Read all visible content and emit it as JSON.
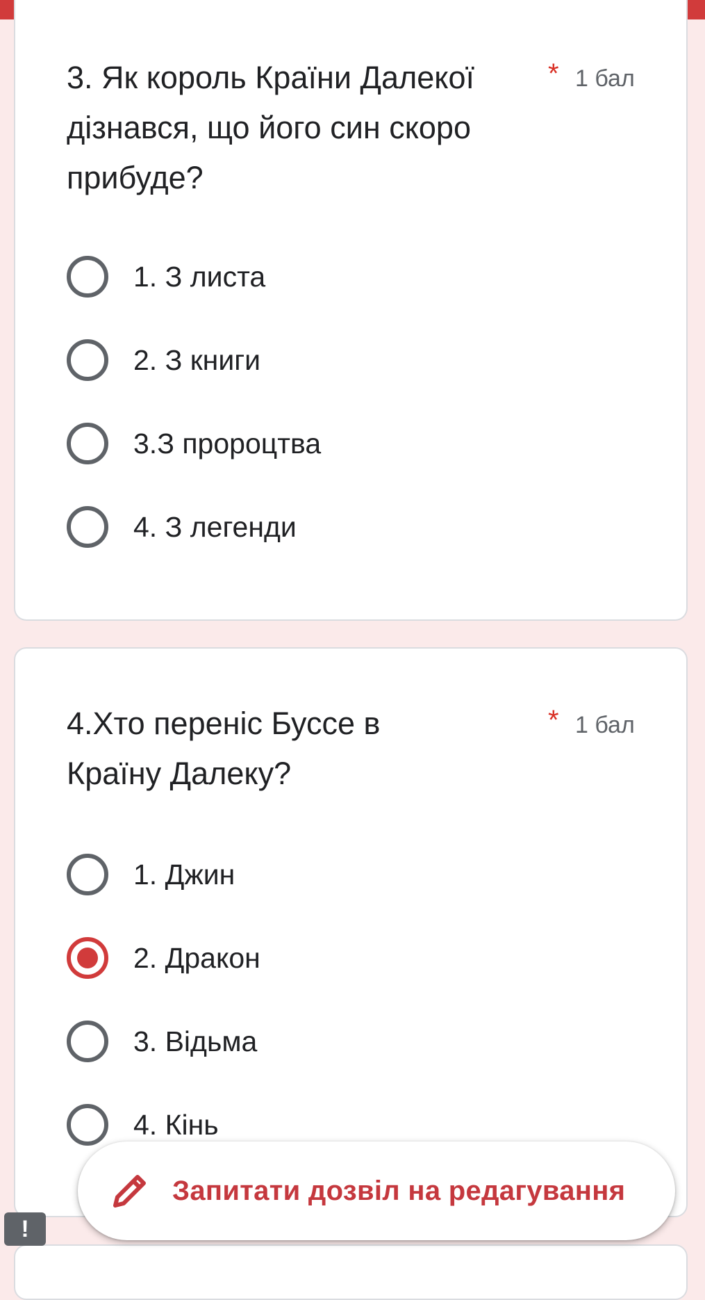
{
  "questions": [
    {
      "title": "3. Як король Країни Далекої дізнався, що його син скоро прибуде?",
      "required_mark": "*",
      "points": "1 бал",
      "options": [
        {
          "label": "1. З листа",
          "selected": false
        },
        {
          "label": "2. З книги",
          "selected": false
        },
        {
          "label": "3.З пророцтва",
          "selected": false
        },
        {
          "label": "4. З легенди",
          "selected": false
        }
      ]
    },
    {
      "title": "4.Хто переніс Буссе в Країну Далеку?",
      "required_mark": "*",
      "points": "1 бал",
      "options": [
        {
          "label": "1. Джин",
          "selected": false
        },
        {
          "label": "2. Дракон",
          "selected": true
        },
        {
          "label": "3. Відьма",
          "selected": false
        },
        {
          "label": "4. Кінь",
          "selected": false
        }
      ]
    }
  ],
  "request_edit": {
    "label": "Запитати дозвіл на редагування",
    "icon": "pencil-icon"
  },
  "feedback": {
    "glyph": "!",
    "icon": "feedback-icon"
  },
  "colors": {
    "accent": "#d13b3b",
    "background": "#fbeaea",
    "required": "#d93025"
  }
}
